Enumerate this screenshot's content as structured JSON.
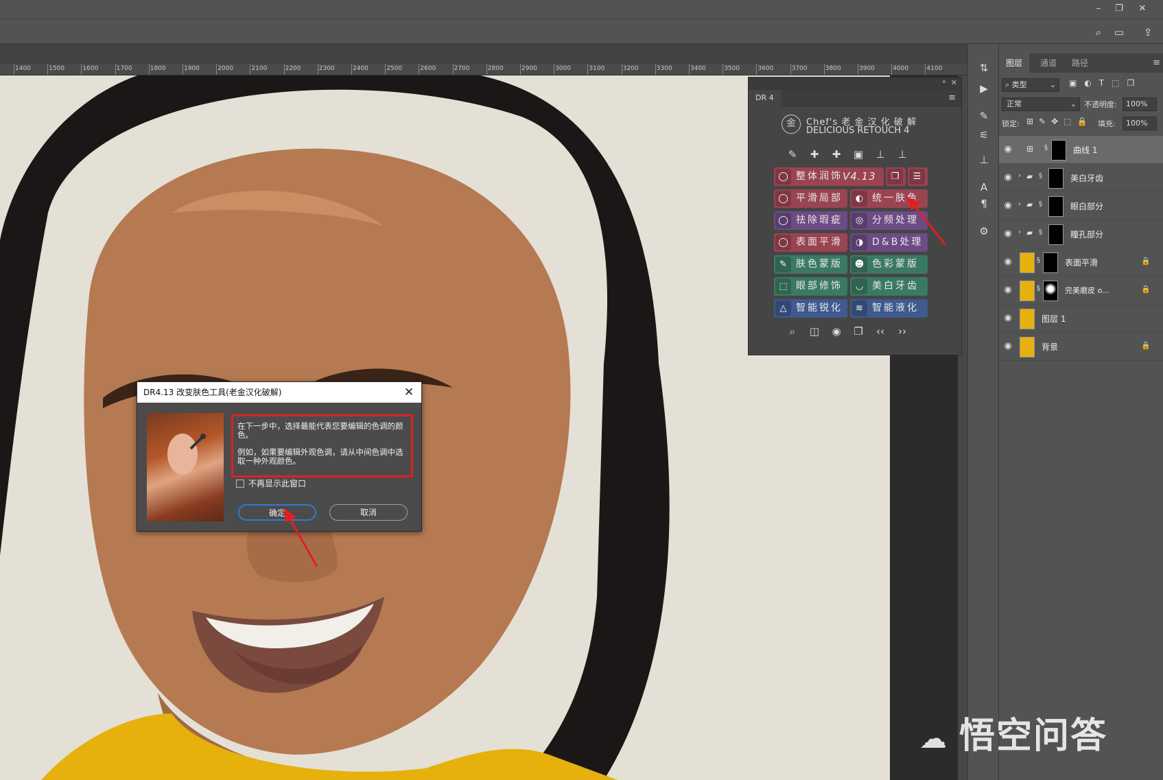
{
  "window": {
    "min_icon": "minimize-icon",
    "restore_icon": "restore-icon",
    "close_icon": "close-icon"
  },
  "ruler": {
    "ticks": [
      "1400",
      "1500",
      "1600",
      "1700",
      "1800",
      "1900",
      "2000",
      "2100",
      "2200",
      "2300",
      "2400",
      "2500",
      "2600",
      "2700",
      "2800",
      "2900",
      "3000",
      "3100",
      "3200",
      "3300",
      "3400",
      "3500",
      "3600",
      "3700",
      "3800",
      "3900",
      "4000",
      "4100"
    ]
  },
  "dr4": {
    "tab": "DR 4",
    "brand_line1": "Chef's 老 金 汉 化 破 解",
    "brand_line2": "DELICIOUS RETOUCH 4",
    "buttons": [
      {
        "label": "整体润饰",
        "version": "V4.13",
        "color": "red"
      },
      {
        "label": "平滑局部",
        "color": "red"
      },
      {
        "label": "统一肤色",
        "color": "red"
      },
      {
        "label": "祛除瑕疵",
        "color": "purple"
      },
      {
        "label": "分频处理",
        "color": "purple"
      },
      {
        "label": "表面平滑",
        "color": "red"
      },
      {
        "label": "D&B处理",
        "color": "purple"
      },
      {
        "label": "肤色蒙版",
        "color": "green"
      },
      {
        "label": "色彩蒙版",
        "color": "green"
      },
      {
        "label": "眼部修饰",
        "color": "green"
      },
      {
        "label": "美白牙齿",
        "color": "green"
      },
      {
        "label": "智能锐化",
        "color": "blue"
      },
      {
        "label": "智能液化",
        "color": "blue"
      }
    ],
    "colors": {
      "red": "#9a4452",
      "purple": "#6d4b85",
      "green": "#3b7a62",
      "blue": "#3f5a8e"
    }
  },
  "layers_panel": {
    "tabs": [
      "图层",
      "通道",
      "路径"
    ],
    "filter": "类型",
    "blend_mode": "正常",
    "opacity_label": "不透明度:",
    "opacity_value": "100%",
    "lock_label": "锁定:",
    "fill_label": "填充:",
    "fill_value": "100%",
    "layers": [
      {
        "name": "曲线 1",
        "selected": true
      },
      {
        "name": "美白牙齿",
        "group": true
      },
      {
        "name": "眼白部分",
        "group": true
      },
      {
        "name": "瞳孔部分",
        "group": true
      },
      {
        "name": "表面平滑",
        "locked": true
      },
      {
        "name": "完美磨皮 o...",
        "locked": true
      },
      {
        "name": "图层 1"
      },
      {
        "name": "背景",
        "locked": true
      }
    ]
  },
  "dialog": {
    "title": "DR4.13 改变肤色工具(老金汉化破解)",
    "text1": "在下一步中，选择最能代表您要编辑的色调的颜色。",
    "text2": "例如，如果要编辑外观色调，请从中间色调中选取一种外观颜色。",
    "checkbox_label": "不再显示此窗口",
    "ok_label": "确定",
    "cancel_label": "取消"
  },
  "watermark": "悟空问答"
}
